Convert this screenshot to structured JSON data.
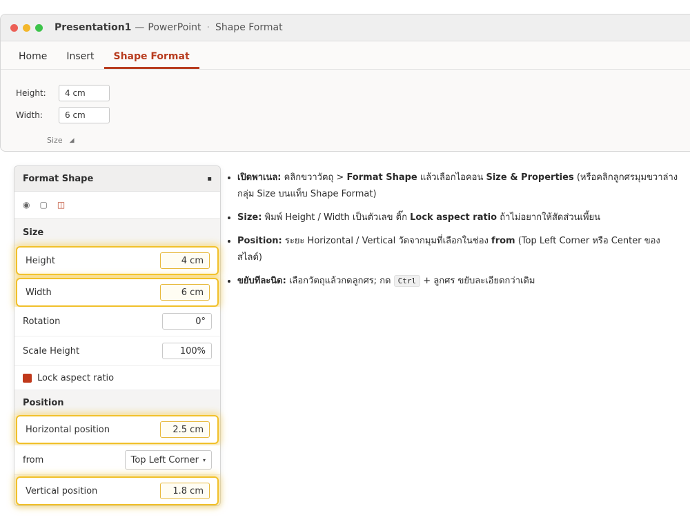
{
  "window": {
    "doc_title": "Presentation1",
    "separator": "—",
    "app_name": "PowerPoint",
    "dot": "·",
    "context": "Shape Format"
  },
  "tabs": [
    "Home",
    "Insert",
    "Shape Format"
  ],
  "ribbon": {
    "height_label": "Height:",
    "height_value": "4 cm",
    "width_label": "Width:",
    "width_value": "6 cm",
    "group_label": "Size"
  },
  "pane": {
    "title": "Format Shape",
    "close": "▪",
    "icons": [
      "fill-line-icon",
      "effects-icon",
      "size-properties-icon"
    ],
    "size_section": "Size",
    "height_label": "Height",
    "height_value": "4 cm",
    "width_label": "Width",
    "width_value": "6 cm",
    "rotation_label": "Rotation",
    "rotation_value": "0°",
    "scale_label": "Scale Height",
    "scale_value": "100%",
    "lock_label": "Lock aspect ratio",
    "position_section": "Position",
    "hpos_label": "Horizontal position",
    "hpos_value": "2.5 cm",
    "from_label": "from",
    "from_value": "Top Left Corner",
    "vpos_label": "Vertical position",
    "vpos_value": "1.8 cm"
  },
  "notes": {
    "n1_b1": "เปิดพาเนล:",
    "n1_t1": " คลิกขวาวัตถุ > ",
    "n1_b2": "Format Shape",
    "n1_t2": " แล้วเลือกไอคอน ",
    "n1_b3": "Size & Properties",
    "n1_t3": " (หรือคลิกลูกศรมุมขวาล่างกลุ่ม Size บนแท็บ Shape Format)",
    "n2_b1": "Size:",
    "n2_t1": " พิมพ์ Height / Width เป็นตัวเลข ติ๊ก ",
    "n2_b2": "Lock aspect ratio",
    "n2_t2": " ถ้าไม่อยากให้สัดส่วนเพี้ยน",
    "n3_b1": "Position:",
    "n3_t1": " ระยะ Horizontal / Vertical วัดจากมุมที่เลือกในช่อง ",
    "n3_b2": "from",
    "n3_t2": " (Top Left Corner หรือ Center ของสไลด์)",
    "n4_b1": "ขยับทีละนิด:",
    "n4_t1": " เลือกวัตถุแล้วกดลูกศร; กด ",
    "n4_kbd": "Ctrl",
    "n4_t2": " + ลูกศร ขยับละเอียดกว่าเดิม"
  }
}
